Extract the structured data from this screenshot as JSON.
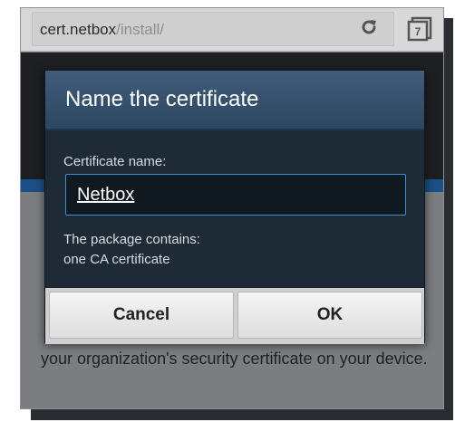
{
  "browser": {
    "url_host": "cert.netbox",
    "url_path": "/install/",
    "tab_count": "7",
    "icons": {
      "reload": "reload-icon",
      "tabs": "tabs-icon"
    }
  },
  "page": {
    "body_text": "your organization's security certificate on your device."
  },
  "dialog": {
    "title": "Name the certificate",
    "field_label": "Certificate name:",
    "field_value": "Netbox",
    "package_line1": "The package contains:",
    "package_line2": "one CA certificate",
    "cancel_label": "Cancel",
    "ok_label": "OK"
  },
  "colors": {
    "dialog_bg": "#1e2b37",
    "dialog_header": "#3f5c7a",
    "input_border": "#3a8fd0",
    "page_accent": "#1c4f85"
  }
}
